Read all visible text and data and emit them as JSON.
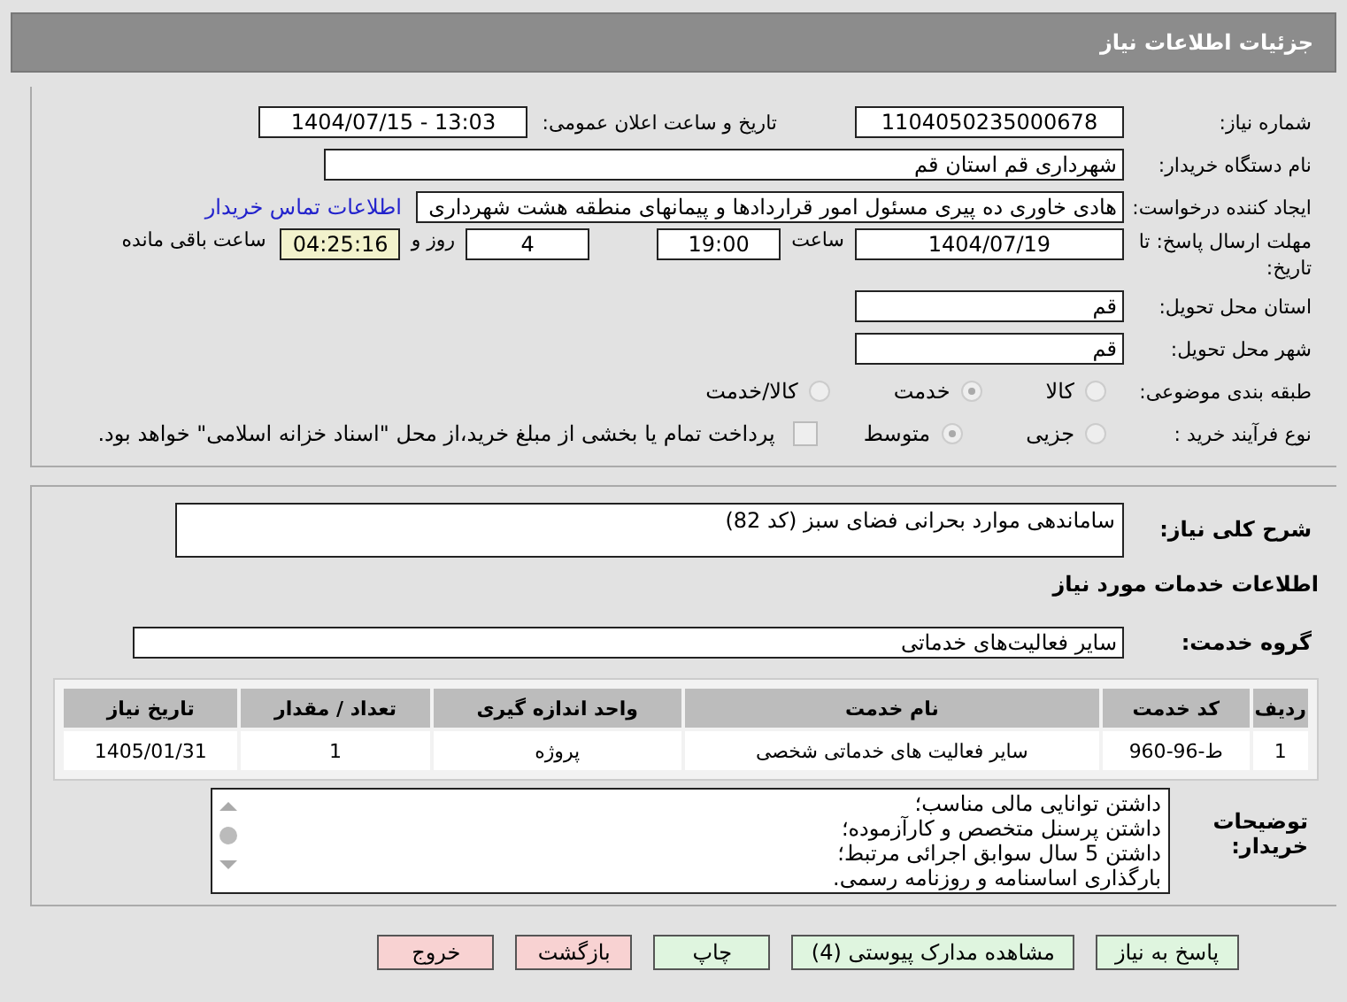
{
  "header": {
    "title": "جزئیات اطلاعات نیاز"
  },
  "details": {
    "need_number": {
      "label": "شماره نیاز:",
      "value": "1104050235000678"
    },
    "announce": {
      "label": "تاریخ و ساعت اعلان عمومی:",
      "value": "1404/07/15 - 13:03"
    },
    "buyer": {
      "label": "نام دستگاه خریدار:",
      "value": "شهرداری قم استان قم"
    },
    "creator": {
      "label": "ایجاد کننده درخواست:",
      "value": "هادی خاوری ده پیری مسئول امور قراردادها و پیمانهای منطقه هشت شهرداری",
      "link": "اطلاعات تماس خریدار"
    },
    "deadline": {
      "label": "مهلت ارسال پاسخ: تا تاریخ:",
      "date": "1404/07/19",
      "time_label": "ساعت",
      "time": "19:00",
      "days": "4",
      "days_label": "روز و",
      "remaining": "04:25:16",
      "remaining_label": "ساعت باقی مانده"
    },
    "province": {
      "label": "استان محل تحویل:",
      "value": "قم"
    },
    "city": {
      "label": "شهر محل تحویل:",
      "value": "قم"
    },
    "category": {
      "label": "طبقه بندی موضوعی:",
      "options": [
        {
          "label": "کالا",
          "selected": false
        },
        {
          "label": "خدمت",
          "selected": true
        },
        {
          "label": "کالا/خدمت",
          "selected": false
        }
      ]
    },
    "purchase_type": {
      "label": "نوع فرآیند خرید :",
      "options": [
        {
          "label": "جزیی",
          "selected": false
        },
        {
          "label": "متوسط",
          "selected": true
        }
      ],
      "treasury": {
        "label": "پرداخت تمام یا بخشی از مبلغ خرید،از محل \"اسناد خزانه اسلامی\" خواهد بود.",
        "checked": false
      }
    }
  },
  "summary": {
    "label": "شرح کلی نیاز:",
    "value": "ساماندهی موارد بحرانی فضای سبز (کد 82)"
  },
  "services": {
    "title": "اطلاعات خدمات مورد نیاز",
    "group": {
      "label": "گروه خدمت:",
      "value": "سایر فعالیت‌های خدماتی"
    },
    "table": {
      "columns": [
        "ردیف",
        "کد خدمت",
        "نام خدمت",
        "واحد اندازه گیری",
        "تعداد / مقدار",
        "تاریخ نیاز"
      ],
      "rows": [
        [
          "1",
          "ط-96-960",
          "سایر فعالیت های خدماتی شخصی",
          "پروژه",
          "1",
          "1405/01/31"
        ]
      ]
    }
  },
  "buyer_notes": {
    "label": "توضیحات خریدار:",
    "lines": [
      "داشتن توانایی مالی مناسب؛",
      "داشتن پرسنل متخصص و کارآزموده؛",
      "داشتن 5 سال سوابق اجرائی مرتبط؛",
      "بارگذاری اساسنامه و روزنامه رسمی."
    ]
  },
  "buttons": [
    {
      "label": "پاسخ به نیاز",
      "kind": "normal"
    },
    {
      "label": "مشاهده مدارک پیوستی (4)",
      "kind": "normal"
    },
    {
      "label": "چاپ",
      "kind": "normal"
    },
    {
      "label": "بازگشت",
      "kind": "exit"
    },
    {
      "label": "خروج",
      "kind": "exit"
    }
  ]
}
